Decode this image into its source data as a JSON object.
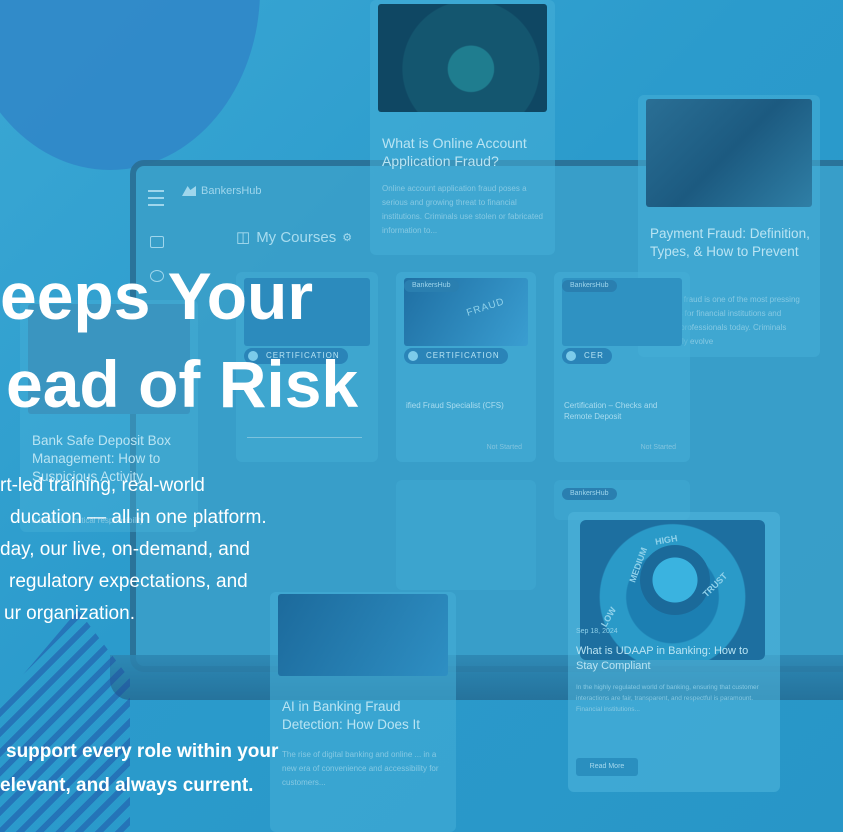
{
  "app": {
    "brand": "BankersHub"
  },
  "sidebar": {
    "page_title": "My Courses"
  },
  "hero": {
    "title_line1": "eeps Your",
    "title_line2": "ead of Risk",
    "para_lines": [
      "rt-led training, real-world",
      "ducation — all in one platform.",
      "day, our live, on-demand, and",
      "regulatory expectations, and",
      "ur organization."
    ],
    "bold_lines": [
      "support every role within your",
      "elevant, and always current."
    ]
  },
  "cards": {
    "online_fraud": {
      "title": "What is Online Account Application Fraud?",
      "body": "Online account application fraud poses a serious and growing threat to financial institutions. Criminals use stolen or fabricated information to..."
    },
    "payment_fraud": {
      "title": "Payment Fraud: Definition, Types, & How to Prevent",
      "body": "Payment fraud is one of the most pressing concerns for financial institutions and banking professionals today. Criminals continually evolve"
    },
    "safe_deposit": {
      "title": "Bank Safe Deposit Box Management: How to Suspicious Activity",
      "body": "a bank is a critical responsibility"
    },
    "cert_fraud": {
      "pill": "BankersHub",
      "badge": "CERTIFICATION",
      "title": "ified Fraud Specialist (CFS)",
      "status": "Not Started",
      "thumb_word": "FRAUD"
    },
    "cert_checks": {
      "pill": "BankersHub",
      "badge": "CER",
      "title": "Certification – Checks and Remote Deposit",
      "status": "Not Started"
    },
    "cert_left": {
      "badge": "CERTIFICATION"
    },
    "ai_fraud": {
      "title": "AI in Banking Fraud Detection: How Does It",
      "body": "The rise of digital banking and online ... in a new era of convenience and accessibility for customers..."
    },
    "udaap": {
      "pill": "BankersHub",
      "date": "Sep 18, 2024",
      "title": "What is UDAAP in Banking: How to Stay Compliant",
      "body": "In the highly regulated world of banking, ensuring that customer interactions are fair, transparent, and respectful is paramount. Financial institutions...",
      "button": "Read More",
      "dial_low": "LOW",
      "dial_medium": "MEDIUM",
      "dial_high": "HIGH",
      "dial_trust": "TRUST"
    }
  },
  "colors": {
    "background": "#2f9fcf",
    "blob": "#3089c8",
    "text": "#ffffff"
  }
}
